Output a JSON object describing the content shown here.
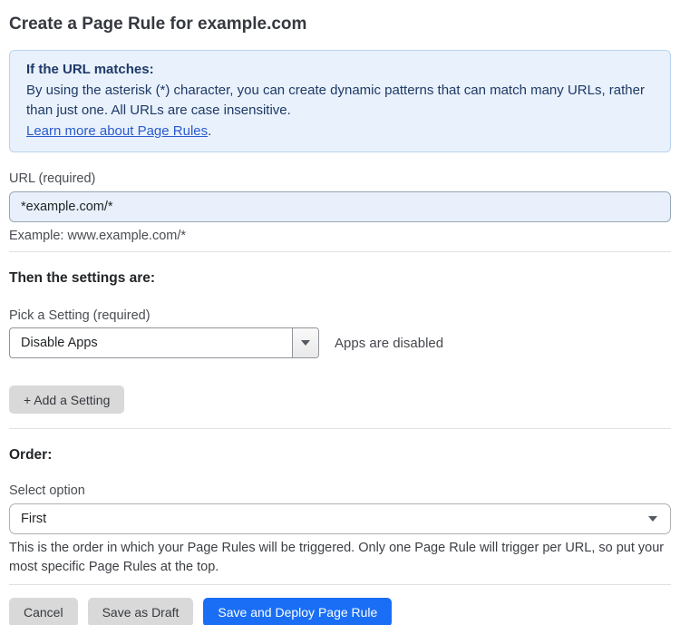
{
  "page": {
    "title": "Create a Page Rule for example.com"
  },
  "info_box": {
    "heading": "If the URL matches:",
    "body": "By using the asterisk (*) character, you can create dynamic patterns that can match many URLs, rather than just one. All URLs are case insensitive.",
    "link_label": "Learn more about Page Rules",
    "link_suffix": "."
  },
  "url_field": {
    "label": "URL (required)",
    "value": "*example.com/*",
    "helper": "Example: www.example.com/*"
  },
  "settings_section": {
    "heading": "Then the settings are:",
    "picker_label": "Pick a Setting (required)",
    "selected_value": "Disable Apps",
    "description": "Apps are disabled",
    "add_setting_label": "+ Add a Setting"
  },
  "order_section": {
    "heading": "Order:",
    "select_label": "Select option",
    "selected_value": "First",
    "helper": "This is the order in which your Page Rules will be triggered. Only one Page Rule will trigger per URL, so put your most specific Page Rules at the top."
  },
  "actions": {
    "cancel_label": "Cancel",
    "save_draft_label": "Save as Draft",
    "save_deploy_label": "Save and Deploy Page Rule"
  },
  "colors": {
    "info_box_bg": "#e9f1fc",
    "info_box_border": "#b9d3ee",
    "info_text": "#1e3a66",
    "link": "#2b5bcc",
    "url_input_bg": "#e9f0fb",
    "primary_button": "#1a6ef5",
    "gray_button": "#d9d9d9",
    "text": "#36393f"
  }
}
